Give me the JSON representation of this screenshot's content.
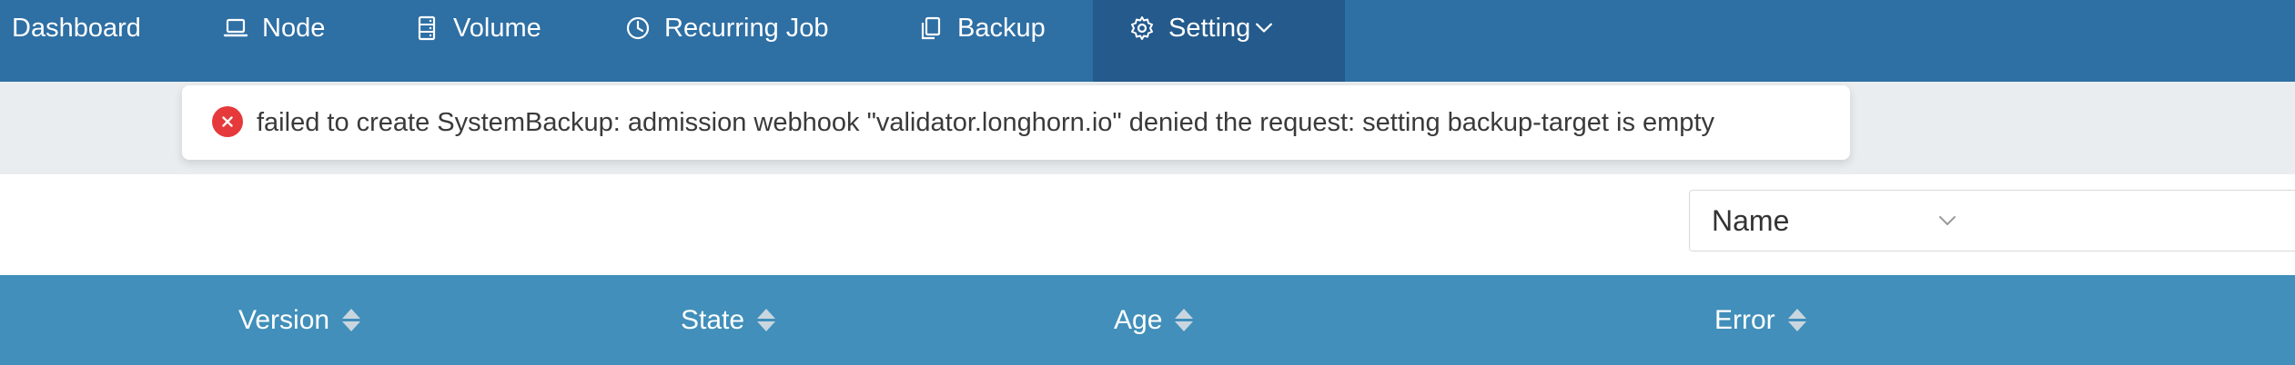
{
  "nav": {
    "items": [
      {
        "label": "Dashboard",
        "icon": "dashboard"
      },
      {
        "label": "Node",
        "icon": "laptop-icon"
      },
      {
        "label": "Volume",
        "icon": "database-icon"
      },
      {
        "label": "Recurring Job",
        "icon": "clock-icon"
      },
      {
        "label": "Backup",
        "icon": "copy-icon"
      },
      {
        "label": "Setting",
        "icon": "gear-icon",
        "active": true
      }
    ]
  },
  "toast": {
    "type": "error",
    "message": "failed to create SystemBackup: admission webhook \"validator.longhorn.io\" denied the request: setting backup-target is empty"
  },
  "filter": {
    "field_value": "Name",
    "search_value": ""
  },
  "table": {
    "columns": [
      "Version",
      "State",
      "Age",
      "Error"
    ]
  },
  "colors": {
    "nav_bg": "#2e6fa4",
    "nav_active_bg": "#245a8c",
    "table_header_bg": "#418fba",
    "error_red": "#e5393b"
  }
}
